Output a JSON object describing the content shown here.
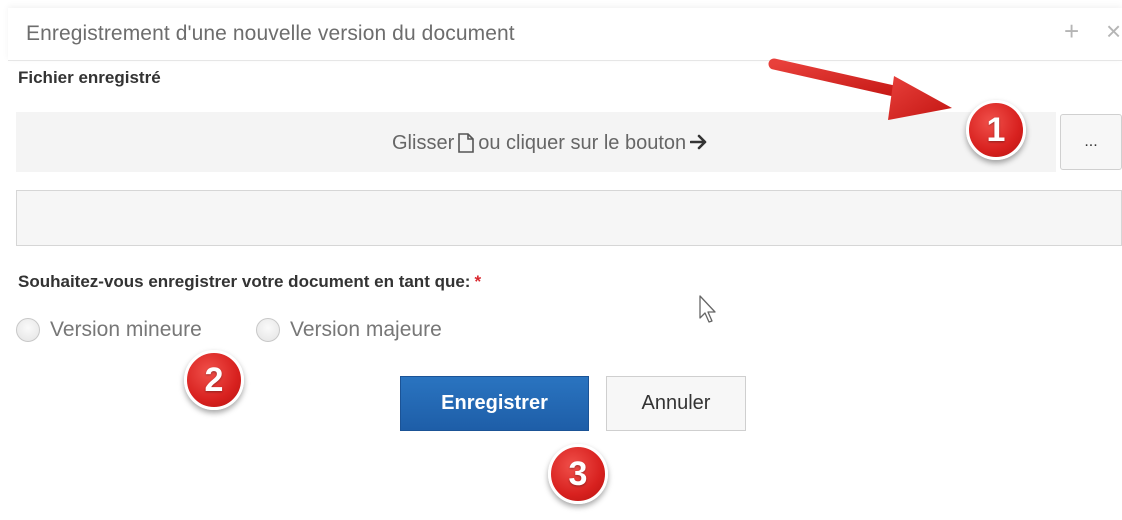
{
  "dialog": {
    "title": "Enregistrement d'une nouvelle version du document",
    "plus_glyph": "+",
    "close_glyph": "×"
  },
  "file_section": {
    "label": "Fichier enregistré",
    "drop_text_before": "Glisser",
    "drop_text_after": "ou cliquer sur le bouton",
    "browse_label": "...",
    "filename_value": ""
  },
  "question": {
    "label": "Souhaitez-vous enregistrer votre document en tant que:",
    "required_mark": "*",
    "options": [
      {
        "label": "Version mineure",
        "selected": false
      },
      {
        "label": "Version majeure",
        "selected": false
      }
    ]
  },
  "actions": {
    "save_label": "Enregistrer",
    "cancel_label": "Annuler"
  },
  "annotations": {
    "step1": "1",
    "step2": "2",
    "step3": "3",
    "color": "#d8211f"
  },
  "colors": {
    "primary": "#1e5ea8",
    "required": "#d9262d"
  },
  "icons": [
    "file-icon",
    "arrow-right-icon",
    "plus-icon",
    "close-icon",
    "mouse-cursor-icon"
  ]
}
